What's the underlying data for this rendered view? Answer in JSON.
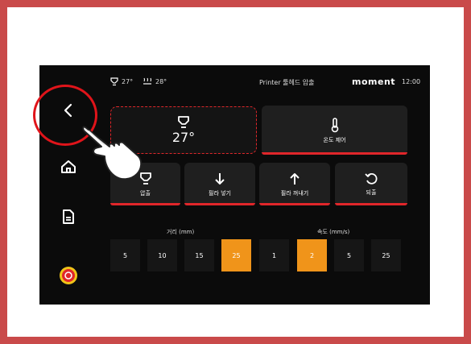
{
  "status": {
    "nozzle_temp": "27°",
    "bed_temp": "28°",
    "title": "Printer 툴헤드 압출",
    "brand": "moment",
    "time": "12:00"
  },
  "cards": {
    "nozzle_temp": "27°",
    "temp_control": "온도 제어",
    "extrude": "압출",
    "load_filament": "필라 넣기",
    "unload_filament": "필라 꺼내기",
    "retract": "되출"
  },
  "distance": {
    "label": "거리 (mm)",
    "options": [
      "5",
      "10",
      "15",
      "25"
    ],
    "selected": "25"
  },
  "speed": {
    "label": "속도 (mm/s)",
    "options": [
      "1",
      "2",
      "5",
      "25"
    ],
    "selected": "2"
  },
  "icons": [
    "back-arrow-icon",
    "home-icon",
    "document-icon",
    "emergency-stop-icon",
    "nozzle-icon",
    "bed-heat-icon",
    "thermometer-icon",
    "arrow-down-icon",
    "arrow-up-icon",
    "retract-icon",
    "pointing-hand-icon"
  ],
  "colors": {
    "accent": "#e0262a",
    "selected": "#f0941a",
    "background": "#0b0b0b",
    "frame": "#c94a4a"
  }
}
